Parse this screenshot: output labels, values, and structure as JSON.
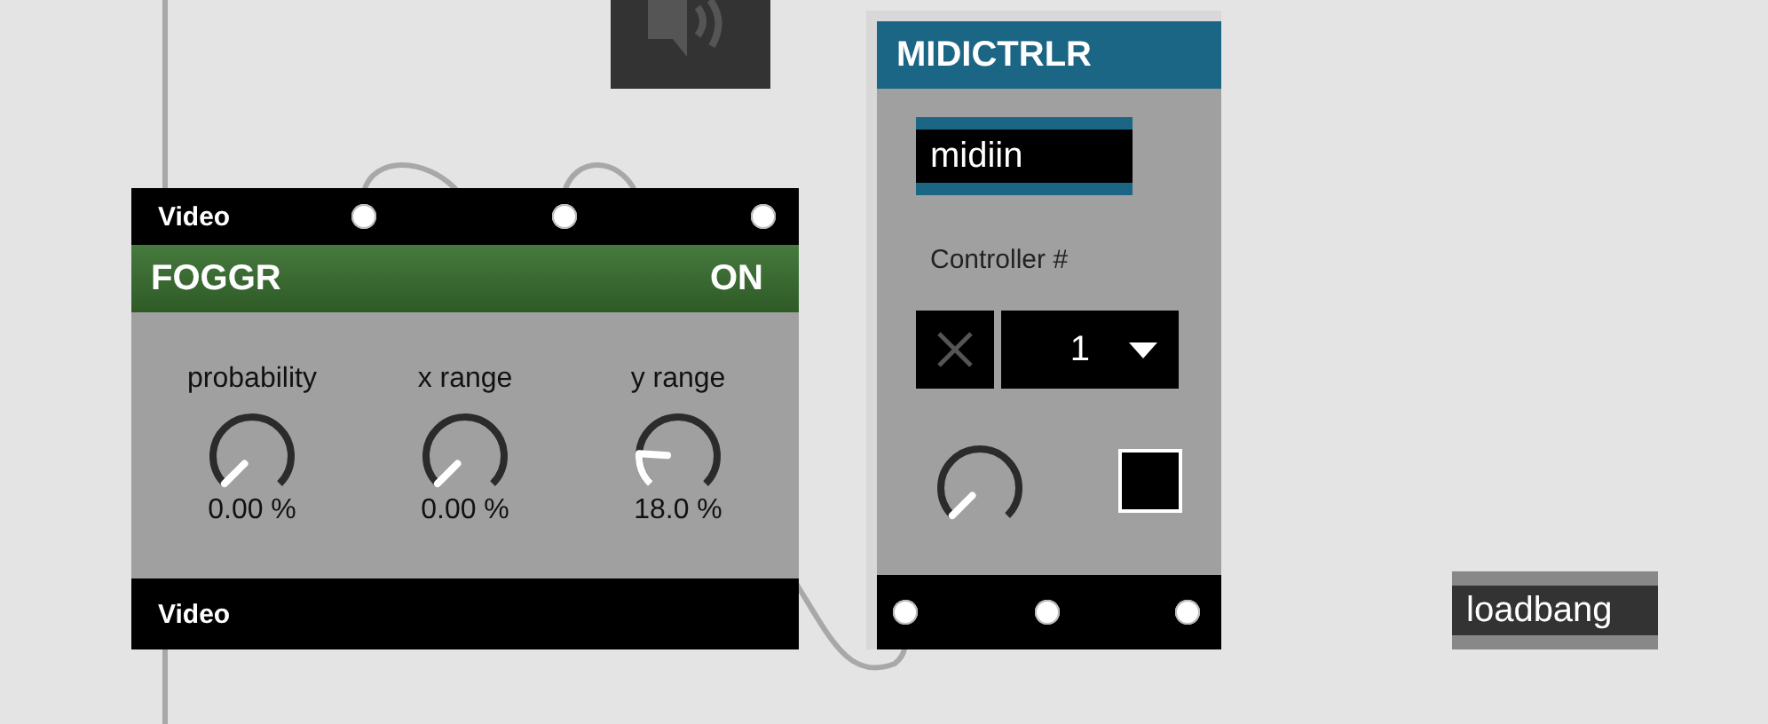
{
  "foggr": {
    "top_label": "Video",
    "title": "FOGGR",
    "status": "ON",
    "bottom_label": "Video",
    "knobs": [
      {
        "label": "probability",
        "reading": "0.00 %"
      },
      {
        "label": "x range",
        "reading": "0.00 %"
      },
      {
        "label": "y range",
        "reading": "18.0 %"
      }
    ]
  },
  "midictrlr": {
    "title": "MIDICTRLR",
    "object": "midiin",
    "controller_label": "Controller #",
    "controller_value": "1",
    "toggle": {
      "checked": false
    }
  },
  "loadbang": {
    "label": "loadbang"
  }
}
